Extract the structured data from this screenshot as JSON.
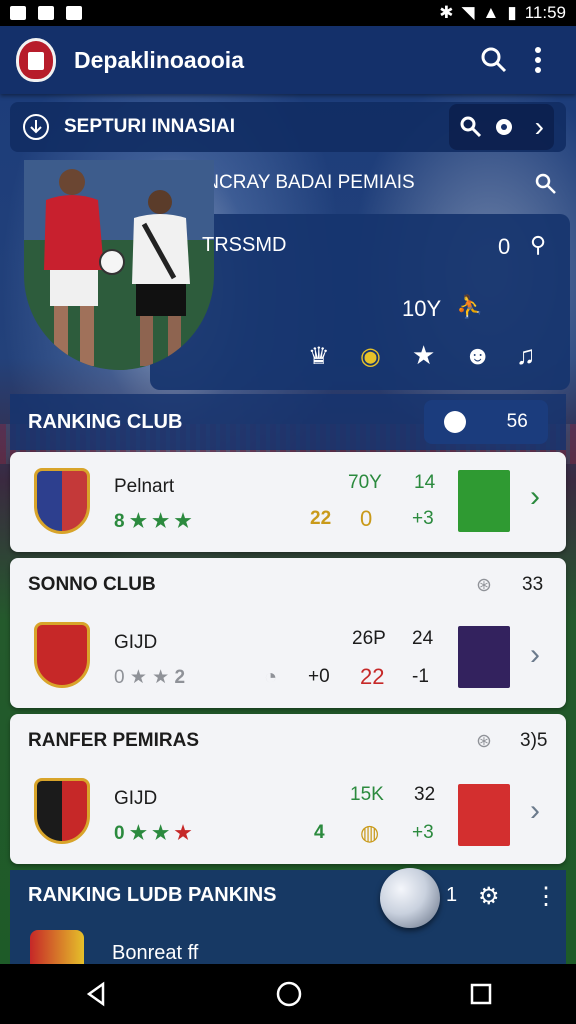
{
  "status": {
    "time": "11:59"
  },
  "app": {
    "title": "Depaklinoaooia"
  },
  "subbar": {
    "title": "SEPTURI INNASIAI"
  },
  "hero": {
    "title": "INCRAY BADAI PEMIAIS",
    "row1_label": "TRSSMD",
    "row1_value": "0",
    "row2_value": "10Y"
  },
  "ranking_header": {
    "title": "RANKING CLUB",
    "value": "56"
  },
  "cards": [
    {
      "name": "Pelnart",
      "stars_prefix": "8",
      "stat_a": "70Y",
      "stat_b": "14",
      "stat_c": "22",
      "stat_d": "0",
      "stat_e": "+3"
    },
    {
      "header": "SONNO CLUB",
      "header_value": "33",
      "name": "GIJD",
      "stars_prefix": "0",
      "stat_a": "26P",
      "stat_b": "24",
      "stat_c": "22",
      "stat_d": "+0",
      "stat_e": "-1"
    },
    {
      "header": "RANFER PEMIRAS",
      "header_value": "3)5",
      "name": "GIJD",
      "stars_prefix": "0",
      "stat_a": "15K",
      "stat_b": "32",
      "stat_c": "4",
      "stat_d": "+3"
    }
  ],
  "bottom_header": {
    "title": "RANKING LUDB PANKINS",
    "value": "1",
    "row_name": "Bonreat ff"
  },
  "colors": {
    "appbar": "#14306a",
    "card": "#f3f4f7",
    "accent_green": "#2b8a3e",
    "accent_red": "#c62828"
  }
}
